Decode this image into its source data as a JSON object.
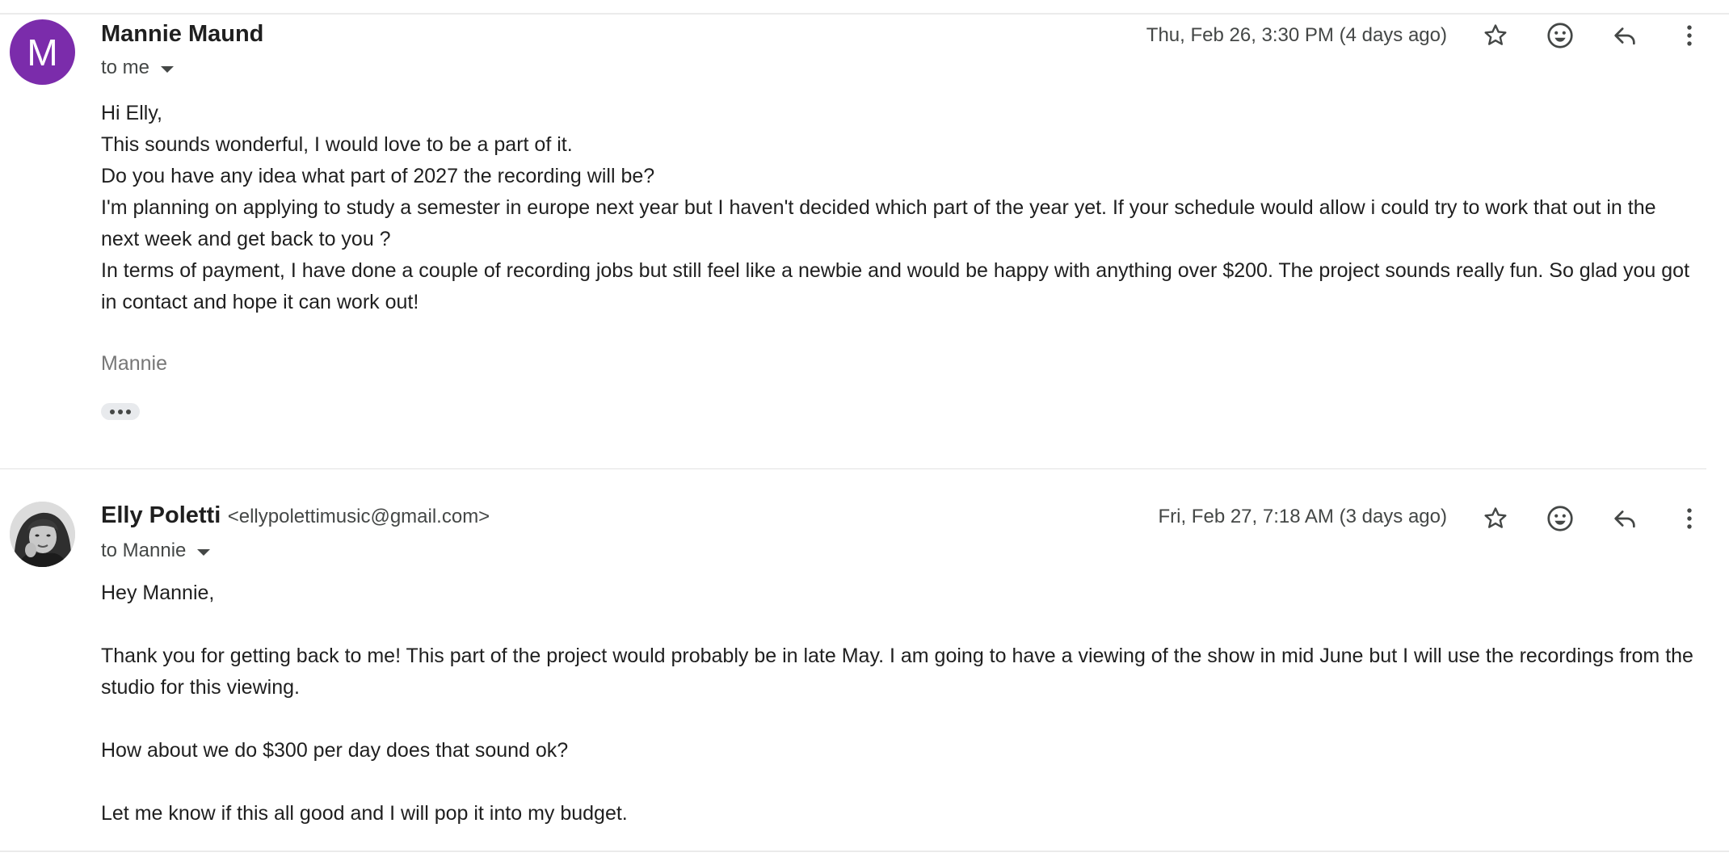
{
  "messages": [
    {
      "avatar_letter": "M",
      "avatar_color": "#7b2cab",
      "sender_name": "Mannie Maund",
      "sender_email": "",
      "recipient": "to me",
      "timestamp": "Thu, Feb 26, 3:30 PM (4 days ago)",
      "body": [
        "Hi Elly,",
        "This sounds wonderful, I would love to be a part of it.",
        "Do you have any idea what part of 2027 the recording will be?",
        "I'm planning on applying to study a semester in europe next year but I haven't decided which part of the year yet. If your schedule would allow i could try to work that out in the next week and get back to you ?",
        "In terms of payment, I have done a couple of recording jobs but still feel like a newbie and would be happy with anything over $200. The project sounds really fun. So glad you got in contact and hope it can work out!"
      ],
      "signature": "Mannie",
      "actions": [
        "star-icon",
        "emoji-icon",
        "reply-icon",
        "more-vertical-icon"
      ]
    },
    {
      "avatar_letter": "",
      "sender_name": "Elly Poletti",
      "sender_email": "<ellypolettimusic@gmail.com>",
      "recipient": "to Mannie",
      "timestamp": "Fri, Feb 27, 7:18 AM (3 days ago)",
      "body": [
        "Hey Mannie,",
        "",
        "Thank you for getting back to me! This part of the project would probably be in late May. I am going to have a viewing of the show in mid June but I will use the recordings from the studio for this viewing.",
        "",
        "How about we do $300 per day does that sound ok?",
        "",
        "Let me know if this all good and I will pop it into my budget."
      ],
      "actions": [
        "star-icon",
        "emoji-icon",
        "reply-icon",
        "more-vertical-icon"
      ]
    }
  ]
}
